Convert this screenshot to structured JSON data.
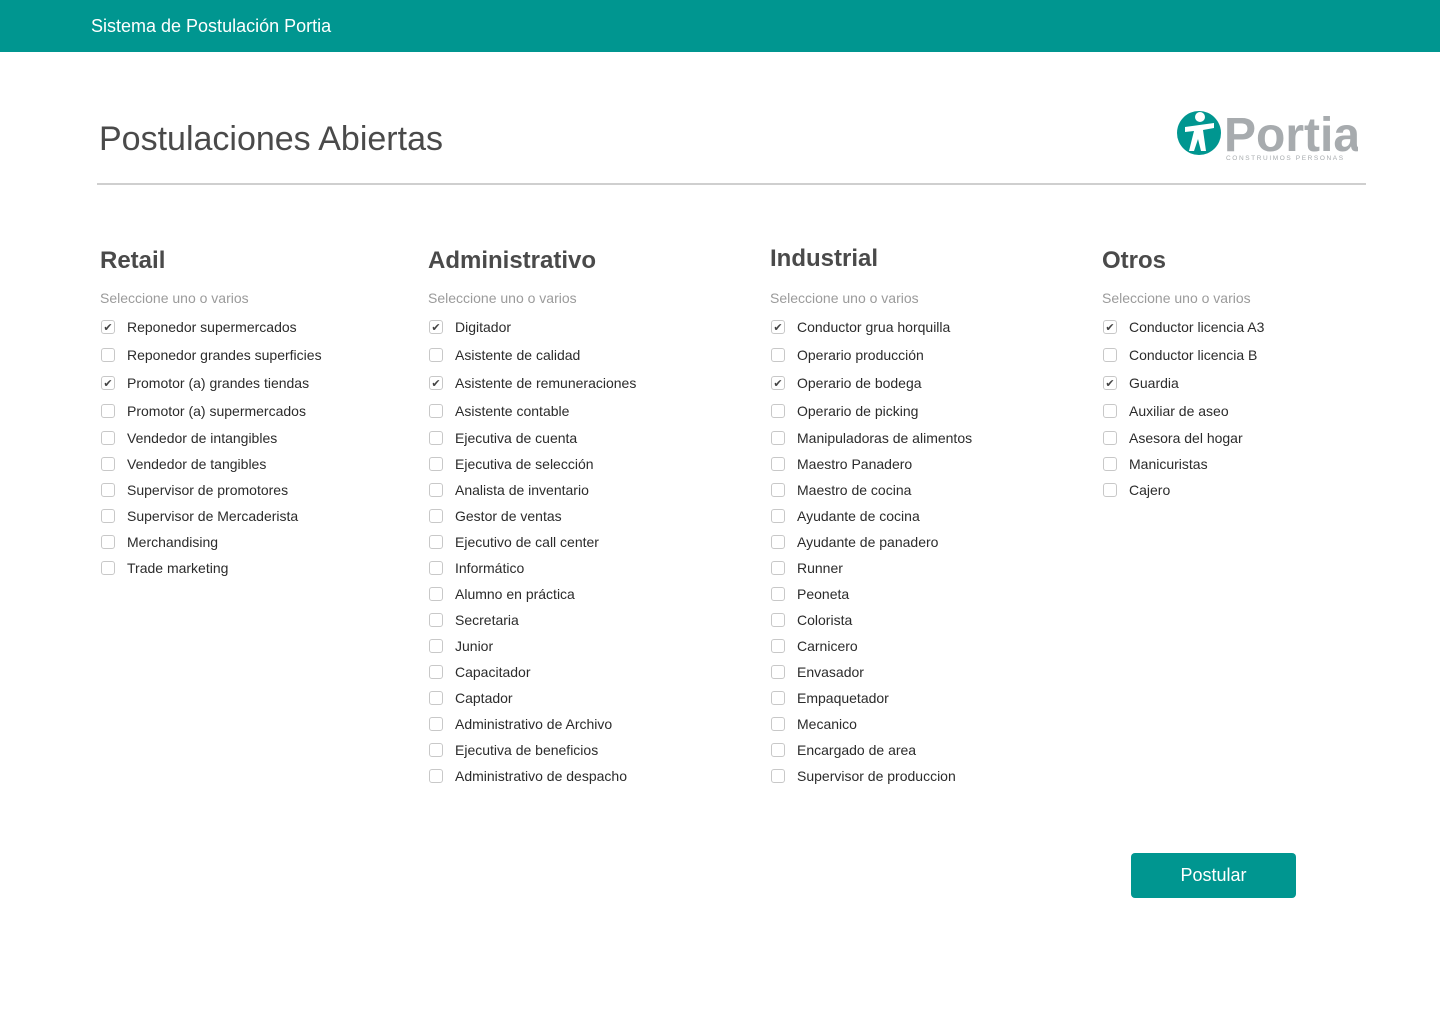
{
  "app": {
    "title": "Sistema de Postulación Portia"
  },
  "page": {
    "title": "Postulaciones Abiertas"
  },
  "logo": {
    "name": "Portia",
    "tagline": "CONSTRUIMOS PERSONAS"
  },
  "colors": {
    "primary": "#009690",
    "logo_gray": "#a7abae"
  },
  "columns": [
    {
      "title": "Retail",
      "hint": "Seleccione uno o varios",
      "items": [
        {
          "label": "Reponedor supermercados",
          "checked": true
        },
        {
          "label": "Reponedor grandes superficies",
          "checked": false
        },
        {
          "label": "Promotor (a) grandes tiendas",
          "checked": true
        },
        {
          "label": "Promotor (a) supermercados",
          "checked": false
        },
        {
          "label": "Vendedor de intangibles",
          "checked": false
        },
        {
          "label": "Vendedor de tangibles",
          "checked": false
        },
        {
          "label": "Supervisor de promotores",
          "checked": false
        },
        {
          "label": "Supervisor de Mercaderista",
          "checked": false
        },
        {
          "label": "Merchandising",
          "checked": false
        },
        {
          "label": "Trade marketing",
          "checked": false
        }
      ]
    },
    {
      "title": "Administrativo",
      "hint": "Seleccione uno o varios",
      "items": [
        {
          "label": "Digitador",
          "checked": true
        },
        {
          "label": "Asistente de calidad",
          "checked": false
        },
        {
          "label": "Asistente de remuneraciones",
          "checked": true
        },
        {
          "label": "Asistente contable",
          "checked": false
        },
        {
          "label": "Ejecutiva de cuenta",
          "checked": false
        },
        {
          "label": "Ejecutiva de selección",
          "checked": false
        },
        {
          "label": "Analista de inventario",
          "checked": false
        },
        {
          "label": "Gestor de ventas",
          "checked": false
        },
        {
          "label": "Ejecutivo de call center",
          "checked": false
        },
        {
          "label": "Informático",
          "checked": false
        },
        {
          "label": "Alumno en práctica",
          "checked": false
        },
        {
          "label": "Secretaria",
          "checked": false
        },
        {
          "label": "Junior",
          "checked": false
        },
        {
          "label": "Capacitador",
          "checked": false
        },
        {
          "label": "Captador",
          "checked": false
        },
        {
          "label": "Administrativo de Archivo",
          "checked": false
        },
        {
          "label": "Ejecutiva de beneficios",
          "checked": false
        },
        {
          "label": "Administrativo de despacho",
          "checked": false
        }
      ]
    },
    {
      "title": "Industrial",
      "hint": "Seleccione uno o varios",
      "items": [
        {
          "label": "Conductor grua horquilla",
          "checked": true
        },
        {
          "label": "Operario producción",
          "checked": false
        },
        {
          "label": "Operario de bodega",
          "checked": true
        },
        {
          "label": "Operario de picking",
          "checked": false
        },
        {
          "label": "Manipuladoras de alimentos",
          "checked": false
        },
        {
          "label": "Maestro Panadero",
          "checked": false
        },
        {
          "label": "Maestro de cocina",
          "checked": false
        },
        {
          "label": "Ayudante de cocina",
          "checked": false
        },
        {
          "label": "Ayudante de panadero",
          "checked": false
        },
        {
          "label": "Runner",
          "checked": false
        },
        {
          "label": "Peoneta",
          "checked": false
        },
        {
          "label": "Colorista",
          "checked": false
        },
        {
          "label": "Carnicero",
          "checked": false
        },
        {
          "label": "Envasador",
          "checked": false
        },
        {
          "label": "Empaquetador",
          "checked": false
        },
        {
          "label": "Mecanico",
          "checked": false
        },
        {
          "label": "Encargado de area",
          "checked": false
        },
        {
          "label": "Supervisor de produccion",
          "checked": false
        }
      ]
    },
    {
      "title": "Otros",
      "hint": "Seleccione uno o varios",
      "items": [
        {
          "label": "Conductor licencia A3",
          "checked": true
        },
        {
          "label": "Conductor licencia B",
          "checked": false
        },
        {
          "label": "Guardia",
          "checked": true
        },
        {
          "label": "Auxiliar de aseo",
          "checked": false
        },
        {
          "label": "Asesora del hogar",
          "checked": false
        },
        {
          "label": "Manicuristas",
          "checked": false
        },
        {
          "label": "Cajero",
          "checked": false
        }
      ]
    }
  ],
  "submit": {
    "label": "Postular"
  }
}
